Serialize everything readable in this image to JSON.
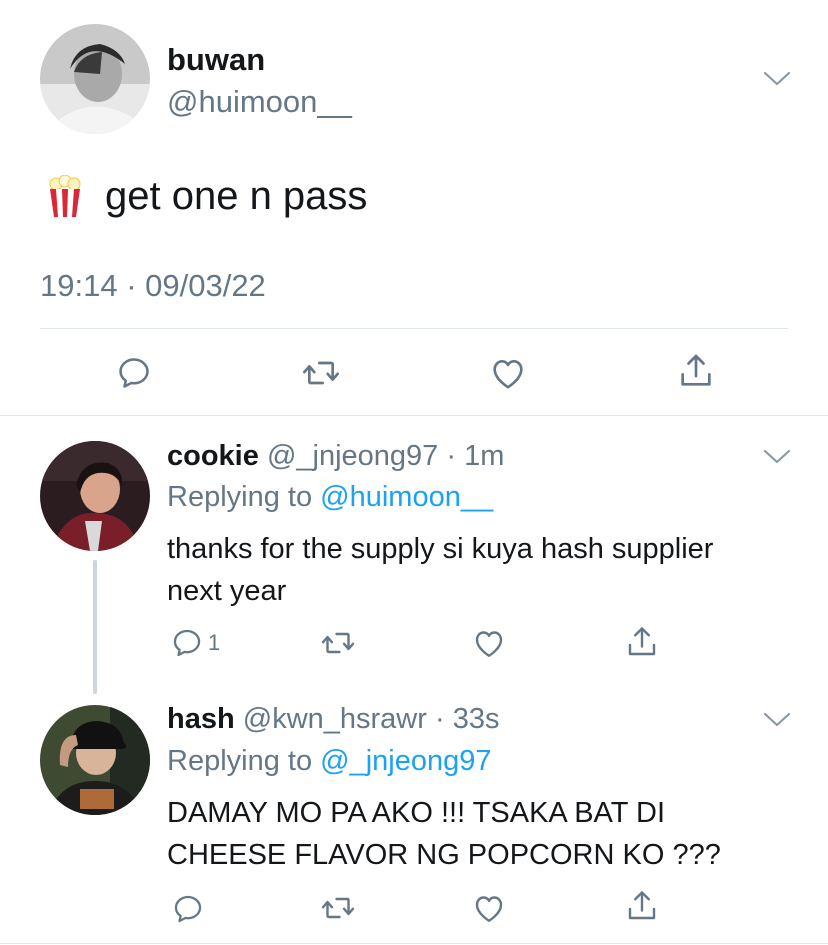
{
  "main_tweet": {
    "display_name": "buwan",
    "handle": "@huimoon__",
    "text": "get one n pass",
    "emoji": "popcorn-icon",
    "timestamp": "19:14 · 09/03/22"
  },
  "replies": [
    {
      "display_name": "cookie",
      "handle": "@_jnjeong97",
      "time": "1m",
      "replying_prefix": "Replying to ",
      "replying_to": "@huimoon__",
      "text_lines": [
        "thanks for the supply si kuya hash supplier",
        "next year"
      ],
      "reply_count": "1"
    },
    {
      "display_name": "hash",
      "handle": "@kwn_hsrawr",
      "time": "33s",
      "replying_prefix": "Replying to ",
      "replying_to": "@_jnjeong97",
      "text_lines": [
        "DAMAY MO PA AKO !!! TSAKA BAT DI",
        "CHEESE FLAVOR NG POPCORN KO ???"
      ]
    }
  ],
  "colors": {
    "text": "#14171a",
    "secondary": "#657786",
    "link": "#1da1f2",
    "divider": "#e1e8ed",
    "thread_line": "#ccd6dd"
  }
}
